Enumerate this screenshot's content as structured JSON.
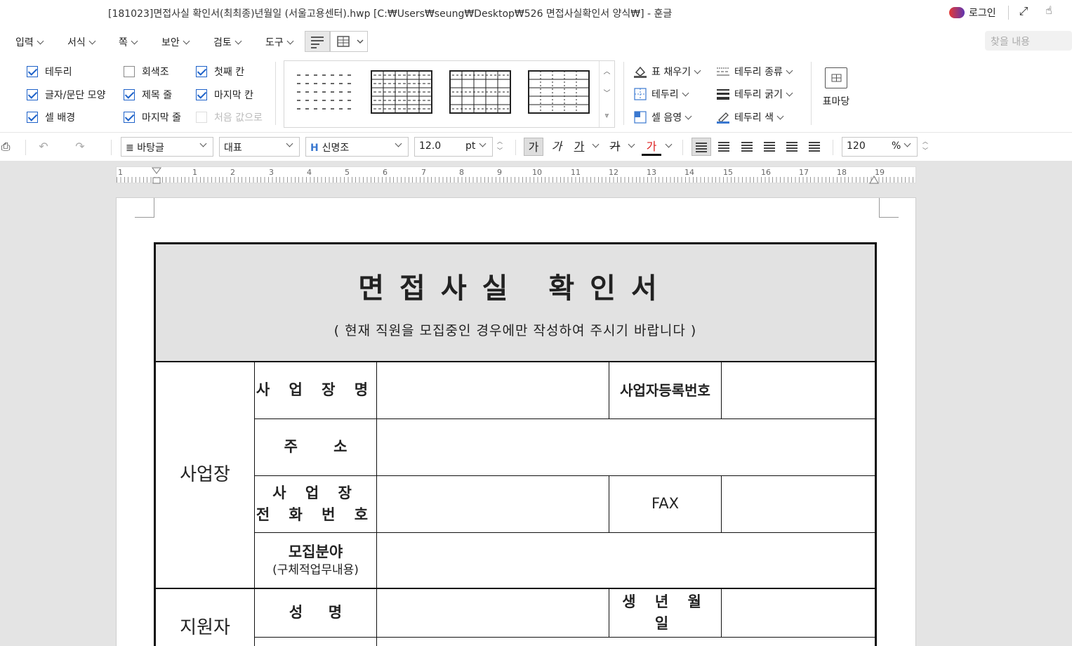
{
  "window": {
    "title": "[181023]면접사실 확인서(최최종)년월일 (서울고용센터).hwp [C:₩Users₩seung₩Desktop₩526 면접사실확인서 양식₩] - 훈글",
    "login_label": "로그인"
  },
  "menu": {
    "items": [
      {
        "label": "입력"
      },
      {
        "label": "서식"
      },
      {
        "label": "쪽"
      },
      {
        "label": "보안"
      },
      {
        "label": "검토"
      },
      {
        "label": "도구"
      }
    ],
    "search_placeholder": "찾을 내용"
  },
  "ribbon": {
    "checkboxes": [
      {
        "label": "테두리",
        "checked": true
      },
      {
        "label": "글자/문단 모양",
        "checked": true
      },
      {
        "label": "셀 배경",
        "checked": true
      },
      {
        "label": "회색조",
        "checked": false
      },
      {
        "label": "제목 줄",
        "checked": true
      },
      {
        "label": "마지막 줄",
        "checked": true
      },
      {
        "label": "첫째 칸",
        "checked": true
      },
      {
        "label": "마지막 칸",
        "checked": true
      },
      {
        "label": "처음 값으로",
        "checked": false,
        "disabled": true
      }
    ],
    "fill_label": "표 채우기",
    "border_label": "테두리",
    "shade_label": "셀 음영",
    "border_type_label": "테두리 종류",
    "border_width_label": "테두리 굵기",
    "border_color_label": "테두리 색",
    "table_madang_label": "표마당"
  },
  "format": {
    "style": "바탕글",
    "lang": "대표",
    "font": "신명조",
    "size": "12.0",
    "size_unit": "pt",
    "zoom": "120",
    "zoom_unit": "%",
    "bold_glyph": "가",
    "italic_glyph": "가",
    "underline_glyph": "가",
    "strike_glyph": "가",
    "color_glyph": "가"
  },
  "ruler": {
    "numbers": [
      "1",
      "1",
      "2",
      "3",
      "4",
      "5",
      "6",
      "7",
      "8",
      "9",
      "10",
      "11",
      "12",
      "13",
      "14",
      "15",
      "16",
      "17",
      "18",
      "19"
    ]
  },
  "form": {
    "title": "면접사실 확인서",
    "subtitle": "( 현재 직원을 모집중인 경우에만 작성하여 주시기 바랍니다 )",
    "section_workplace": "사업장",
    "workplace_name": "사 업 장 명",
    "biz_reg_no": "사업자등록번호",
    "address": "주       소",
    "phone_line1": "사 업 장",
    "phone_line2": "전 화 번 호",
    "fax": "FAX",
    "recruit_field": "모집분야",
    "recruit_detail": "(구체적업무내용)",
    "section_applicant": "지원자",
    "name": "성     명",
    "birth": "생 년 월 일"
  }
}
